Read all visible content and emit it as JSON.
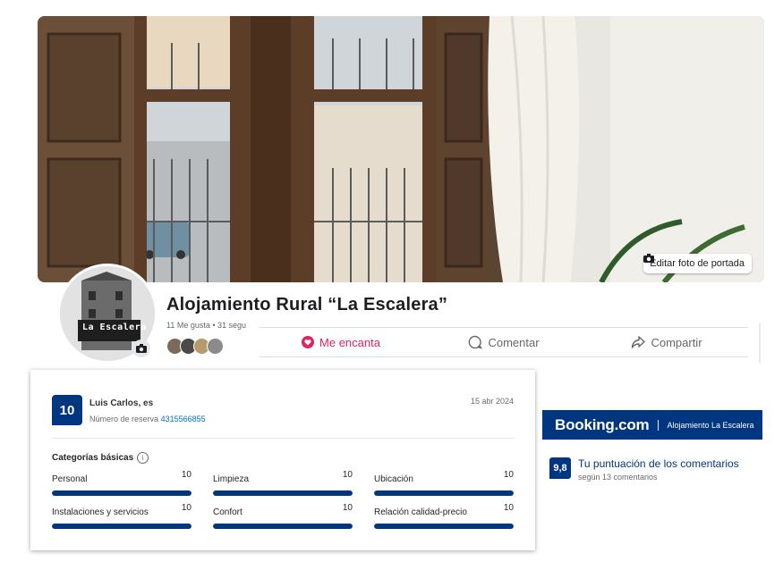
{
  "cover": {
    "edit_label": "Editar foto de portada"
  },
  "page": {
    "title": "Alojamiento Rural “La Escalera”",
    "stats": "11 Me gusta • 31 segu",
    "avatar_logo_text": "La Escalera"
  },
  "actions": {
    "love": "Me encanta",
    "comment": "Comentar",
    "share": "Compartir"
  },
  "review": {
    "score": "10",
    "reviewer": "Luis Carlos, es",
    "booking_label": "Número de reserva",
    "booking_number": "4315566855",
    "date": "15 abr 2024",
    "categories_title": "Categorías básicas",
    "categories": [
      {
        "label": "Personal",
        "value": "10",
        "fill": 1.0
      },
      {
        "label": "Limpieza",
        "value": "10",
        "fill": 1.0
      },
      {
        "label": "Ubicación",
        "value": "10",
        "fill": 1.0
      },
      {
        "label": "Instalaciones y servicios",
        "value": "10",
        "fill": 1.0
      },
      {
        "label": "Confort",
        "value": "10",
        "fill": 1.0
      },
      {
        "label": "Relación calidad-precio",
        "value": "10",
        "fill": 1.0
      }
    ]
  },
  "booking": {
    "logo": "Booking.com",
    "property": "Alojamiento La Escalera",
    "total_score": "9,8",
    "total_title": "Tu puntuación de los comentarios",
    "total_sub": "según 13 comentarios"
  },
  "colors": {
    "booking_blue": "#003580",
    "love_red": "#e0245e",
    "link_blue": "#0071c2"
  }
}
